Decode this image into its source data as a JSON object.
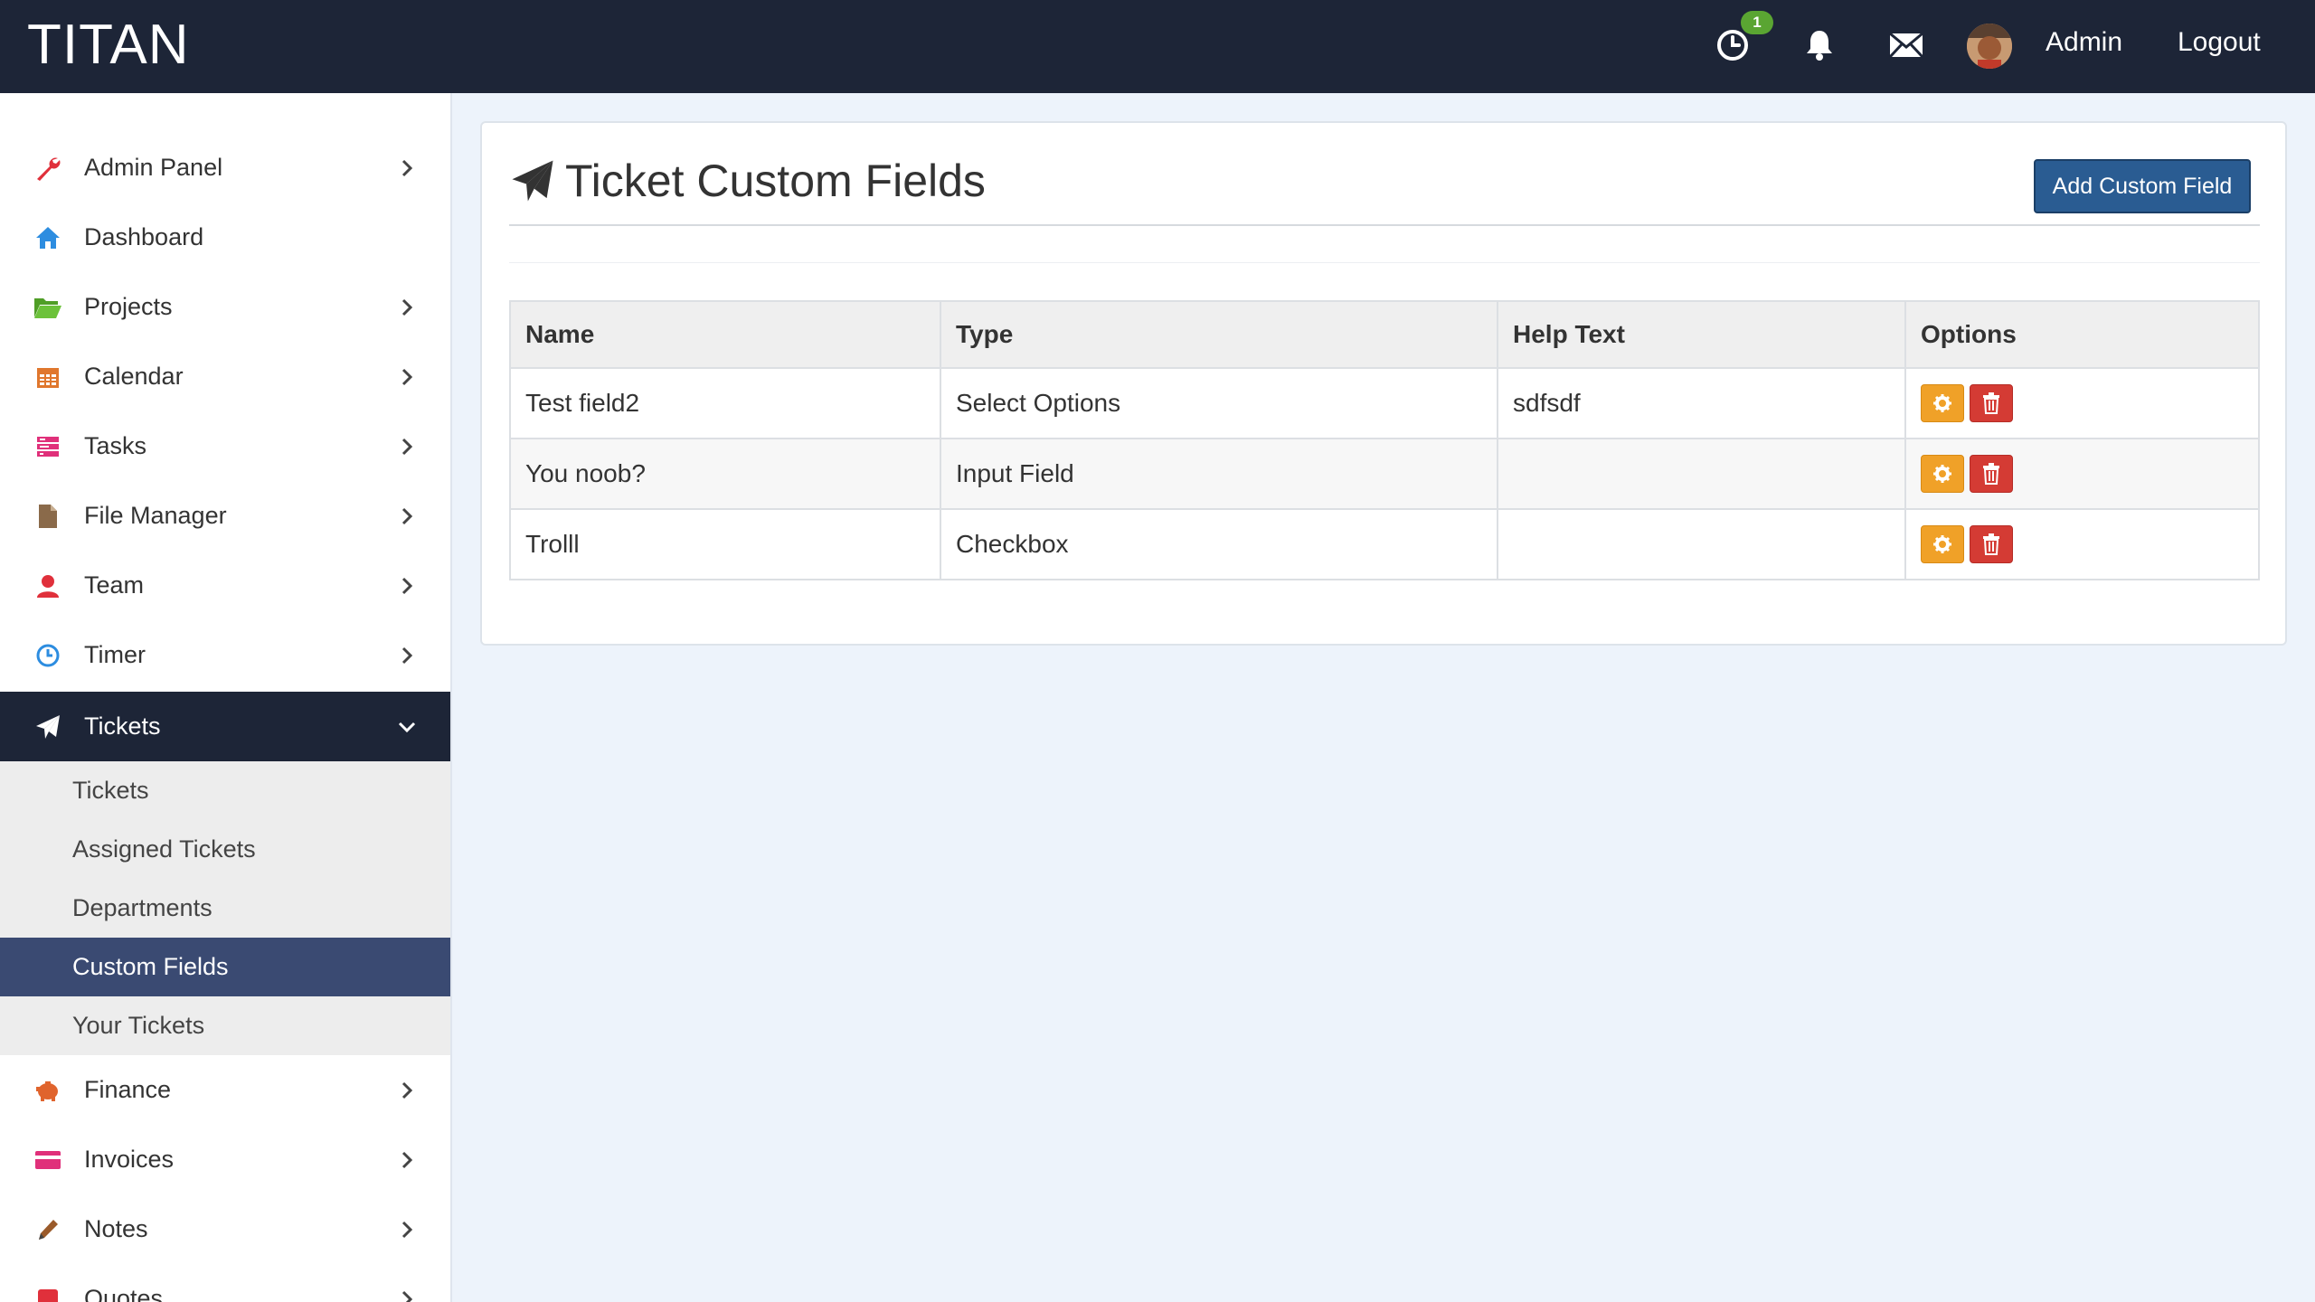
{
  "header": {
    "brand": "TITAN",
    "timer_badge": "1",
    "user_name": "Admin",
    "logout_label": "Logout"
  },
  "sidebar": {
    "items": [
      {
        "label": "Admin Panel",
        "icon": "wrench-icon",
        "color": "#e0303b"
      },
      {
        "label": "Dashboard",
        "icon": "home-icon",
        "color": "#2d8de0"
      },
      {
        "label": "Projects",
        "icon": "folder-open-icon",
        "color": "#5fb832"
      },
      {
        "label": "Calendar",
        "icon": "calendar-icon",
        "color": "#e0772d"
      },
      {
        "label": "Tasks",
        "icon": "tasks-icon",
        "color": "#e0307a"
      },
      {
        "label": "File Manager",
        "icon": "file-icon",
        "color": "#8a6a4a"
      },
      {
        "label": "Team",
        "icon": "user-icon",
        "color": "#e0303b"
      },
      {
        "label": "Timer",
        "icon": "clock-icon",
        "color": "#2d8de0"
      },
      {
        "label": "Tickets",
        "icon": "paper-plane-icon",
        "color": "#ffffff"
      },
      {
        "label": "Finance",
        "icon": "piggy-bank-icon",
        "color": "#e0642d"
      },
      {
        "label": "Invoices",
        "icon": "credit-card-icon",
        "color": "#e0307a"
      },
      {
        "label": "Notes",
        "icon": "pencil-icon",
        "color": "#9a5a2a"
      },
      {
        "label": "Quotes",
        "icon": "quote-icon",
        "color": "#e0303b"
      }
    ],
    "tickets_sub": [
      {
        "label": "Tickets"
      },
      {
        "label": "Assigned Tickets"
      },
      {
        "label": "Departments"
      },
      {
        "label": "Custom Fields"
      },
      {
        "label": "Your Tickets"
      }
    ]
  },
  "main": {
    "title": "Ticket Custom Fields",
    "add_button": "Add Custom Field",
    "table": {
      "headers": [
        "Name",
        "Type",
        "Help Text",
        "Options"
      ],
      "rows": [
        {
          "name": "Test field2",
          "type": "Select Options",
          "help": "sdfsdf"
        },
        {
          "name": "You noob?",
          "type": "Input Field",
          "help": ""
        },
        {
          "name": "Trolll",
          "type": "Checkbox",
          "help": ""
        }
      ]
    }
  }
}
